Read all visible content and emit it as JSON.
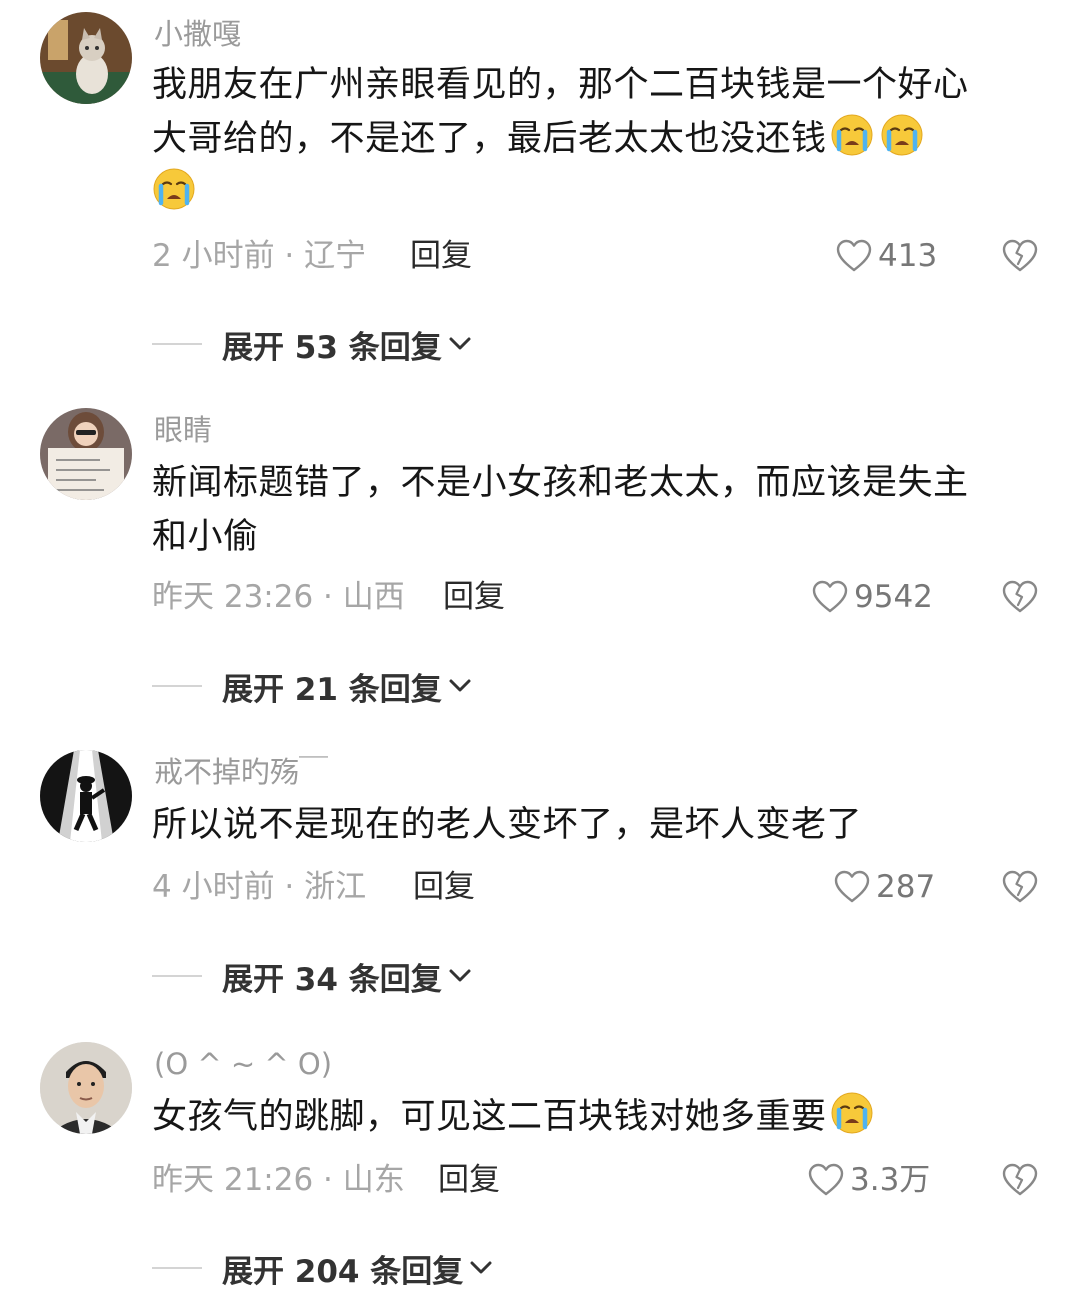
{
  "comments": [
    {
      "username": "小撒嘎",
      "text_lines": [
        "我朋友在广州亲眼看见的，那个二百块钱是一个好心",
        "大哥给的，不是还了，最后老太太也没还钱"
      ],
      "meta": "2 小时前 · 辽宁",
      "reply": "回复",
      "likes": "413",
      "expand": "展开 53 条回复",
      "avatar_icon": "cat-avatar"
    },
    {
      "username": "眼睛",
      "text_lines": [
        "新闻标题错了，不是小女孩和老太太，而应该是失主",
        "和小偷"
      ],
      "meta": "昨天 23:26 · 山西",
      "reply": "回复",
      "likes": "9542",
      "expand": "展开 21 条回复",
      "avatar_icon": "person-with-sign-avatar"
    },
    {
      "username": "戒不掉旳殇￣",
      "text_lines": [
        "所以说不是现在的老人变坏了，是坏人变老了"
      ],
      "meta": "4 小时前 · 浙江",
      "reply": "回复",
      "likes": "287",
      "expand": "展开 34 条回复",
      "avatar_icon": "dancer-silhouette-avatar"
    },
    {
      "username": "(O ^ ~ ^ O)",
      "text_lines": [
        "女孩气的跳脚，可见这二百块钱对她多重要"
      ],
      "meta": "昨天 21:26 · 山东",
      "reply": "回复",
      "likes": "3.3万",
      "expand": "展开 204 条回复",
      "avatar_icon": "man-portrait-avatar"
    }
  ],
  "colors": {
    "username": "#9a9a9a",
    "text": "#161616",
    "meta": "#a6a6a6",
    "emoji_face": "#f7c93a"
  },
  "icons": {
    "like": "heart-outline-icon",
    "dislike": "broken-heart-icon",
    "expand": "chevron-down-icon",
    "emoji": "crying-face-emoji"
  }
}
